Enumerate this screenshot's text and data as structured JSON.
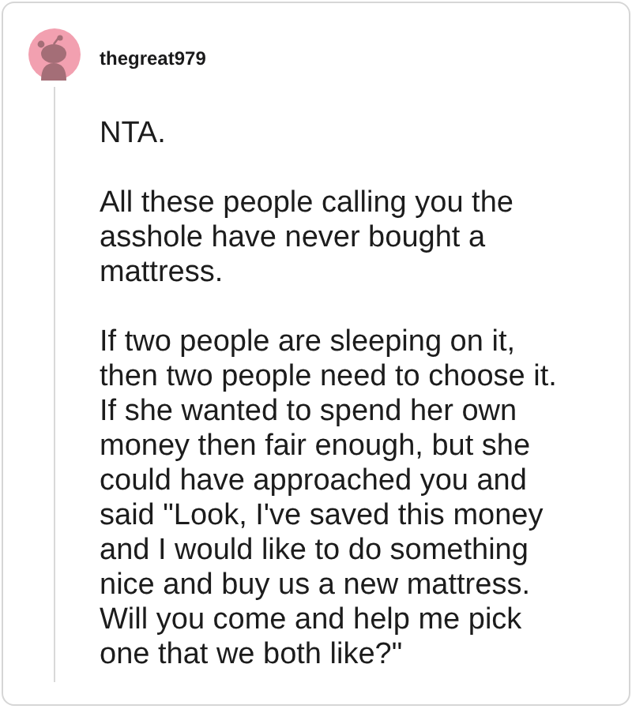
{
  "comment": {
    "username": "thegreat979",
    "paragraphs": [
      "NTA.",
      "All these people calling you the asshole have never bought a mattress.",
      "If two people are sleeping on it, then two people need to choose it. If she wanted to spend her own money then fair enough, but she could have approached you and said \"Look, I've saved this money and I would like to do something nice and buy us a new mattress. Will you come and help me pick one that we both like?\""
    ]
  }
}
